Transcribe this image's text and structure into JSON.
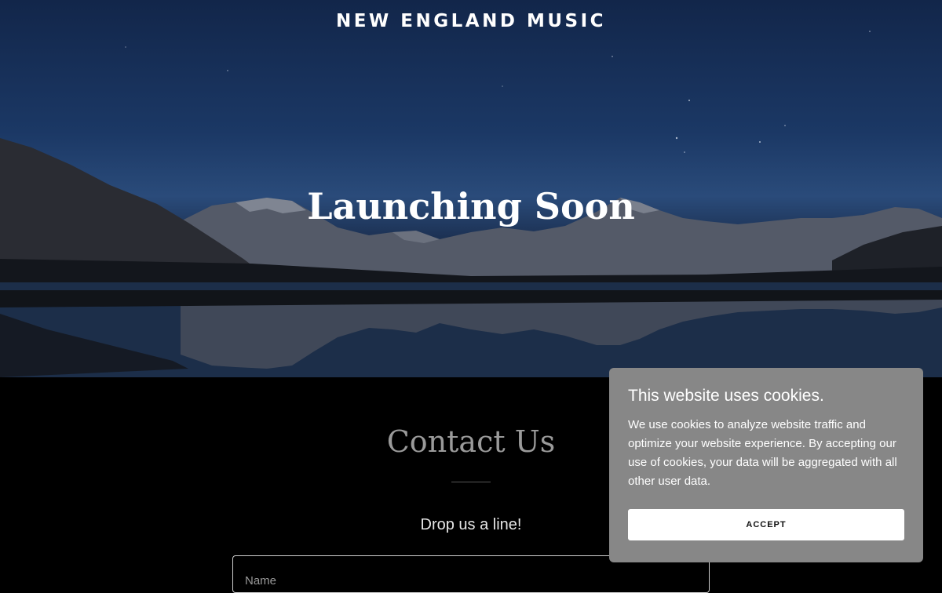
{
  "header": {
    "brand": "NEW ENGLAND MUSIC"
  },
  "hero": {
    "title": "Launching Soon"
  },
  "contact": {
    "title": "Contact Us",
    "subtitle": "Drop us a line!",
    "name_placeholder": "Name"
  },
  "cookie_banner": {
    "title": "This website uses cookies.",
    "body": "We use cookies to analyze website traffic and optimize your website experience. By accepting our use of cookies, your data will be aggregated with all other user data.",
    "accept_label": "ACCEPT"
  },
  "colors": {
    "sky_top": "#12264a",
    "page_background": "#000000",
    "cookie_background": "#878787",
    "contact_title": "#9a9a9a"
  }
}
